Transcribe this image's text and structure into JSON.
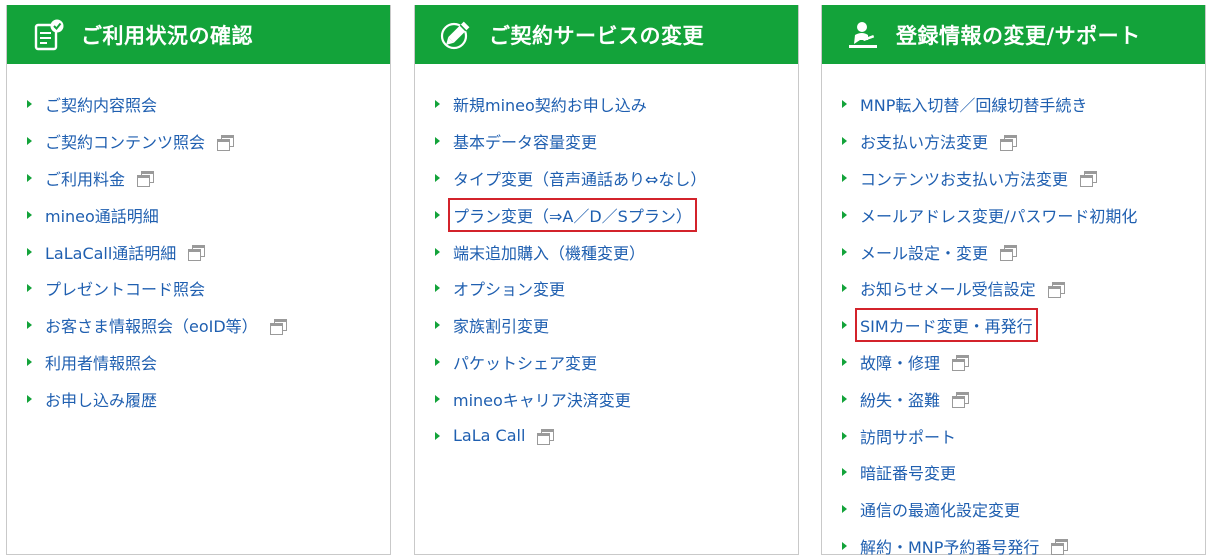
{
  "panels": [
    {
      "title": "ご利用状況の確認",
      "icon": "clipboard-check-icon",
      "items": [
        {
          "label": "ご契約内容照会",
          "external": false
        },
        {
          "label": "ご契約コンテンツ照会",
          "external": true
        },
        {
          "label": "ご利用料金",
          "external": true
        },
        {
          "label": "mineo通話明細",
          "external": false
        },
        {
          "label": "LaLaCall通話明細",
          "external": true
        },
        {
          "label": "プレゼントコード照会",
          "external": false
        },
        {
          "label": "お客さま情報照会（eoID等）",
          "external": true
        },
        {
          "label": "利用者情報照会",
          "external": false
        },
        {
          "label": "お申し込み履歴",
          "external": false
        }
      ]
    },
    {
      "title": "ご契約サービスの変更",
      "icon": "pencil-icon",
      "items": [
        {
          "label": "新規mineo契約お申し込み",
          "external": false
        },
        {
          "label": "基本データ容量変更",
          "external": false
        },
        {
          "label": "タイプ変更（音声通話あり⇔なし）",
          "external": false
        },
        {
          "label": "プラン変更（⇒A／D／Sプラン）",
          "external": false,
          "highlighted": true
        },
        {
          "label": "端末追加購入（機種変更）",
          "external": false
        },
        {
          "label": "オプション変更",
          "external": false
        },
        {
          "label": "家族割引変更",
          "external": false
        },
        {
          "label": "パケットシェア変更",
          "external": false
        },
        {
          "label": "mineoキャリア決済変更",
          "external": false
        },
        {
          "label": "LaLa Call",
          "external": true
        }
      ]
    },
    {
      "title": "登録情報の変更/サポート",
      "icon": "user-desk-icon",
      "items": [
        {
          "label": "MNP転入切替／回線切替手続き",
          "external": false
        },
        {
          "label": "お支払い方法変更",
          "external": true
        },
        {
          "label": "コンテンツお支払い方法変更",
          "external": true
        },
        {
          "label": "メールアドレス変更/パスワード初期化",
          "external": false
        },
        {
          "label": "メール設定・変更",
          "external": true
        },
        {
          "label": "お知らせメール受信設定",
          "external": true
        },
        {
          "label": "SIMカード変更・再発行",
          "external": false,
          "highlighted": true
        },
        {
          "label": "故障・修理",
          "external": true
        },
        {
          "label": "紛失・盗難",
          "external": true
        },
        {
          "label": "訪問サポート",
          "external": false
        },
        {
          "label": "暗証番号変更",
          "external": false
        },
        {
          "label": "通信の最適化設定変更",
          "external": false
        },
        {
          "label": "解約・MNP予約番号発行",
          "external": true
        }
      ]
    }
  ],
  "colors": {
    "header_bg": "#13a33a",
    "link": "#1f5fb0",
    "bullet": "#13a33a",
    "highlight_border": "#d3232b"
  }
}
